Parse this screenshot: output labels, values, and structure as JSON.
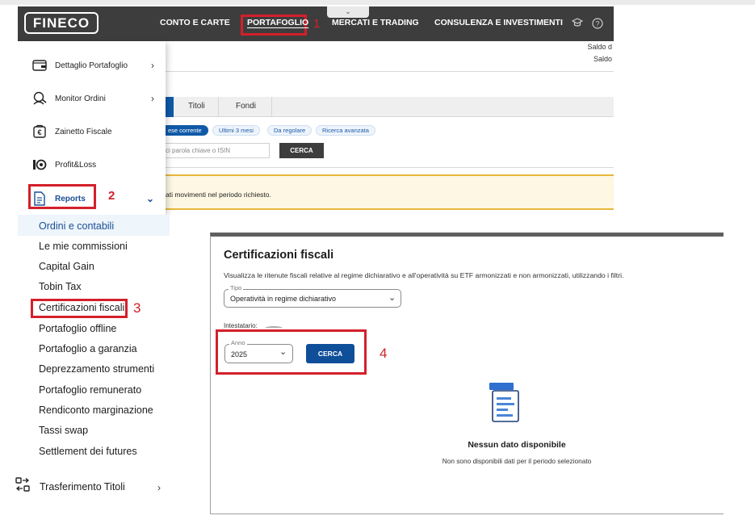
{
  "top_screenshot": {
    "logo": "FINECO",
    "nav": [
      "CONTO E CARTE",
      "PORTAFOGLIO",
      "MERCATI E TRADING",
      "CONSULENZA E INVESTIMENTI"
    ],
    "step1": "1",
    "saldo_lines": [
      "Saldo d",
      "Saldo"
    ],
    "dropdown": {
      "items": [
        {
          "label": "Dettaglio Portafoglio",
          "icon": "wallet-icon"
        },
        {
          "label": "Monitor Ordini",
          "icon": "order-monitor-icon"
        },
        {
          "label": "Zainetto Fiscale",
          "icon": "tax-backpack-icon"
        },
        {
          "label": "Profit&Loss",
          "icon": "profit-loss-icon"
        },
        {
          "label": "Reports",
          "icon": "document-icon"
        }
      ],
      "step2": "2"
    },
    "subtabs": [
      "Titoli",
      "Fondi"
    ],
    "filters": [
      "ese corrente",
      "Ultimi 3 mesi",
      "Da regolare",
      "Ricerca avanzata"
    ],
    "search_placeholder": "sci parola chiave o ISIN",
    "search_button": "CERCA",
    "banner_text": "ati movimenti nel periodo richiesto."
  },
  "reports_submenu": {
    "items": [
      "Ordini e contabili",
      "Le mie commissioni",
      "Capital Gain",
      "Tobin Tax",
      "Certificazioni fiscali",
      "Portafoglio offline",
      "Portafoglio a garanzia",
      "Deprezzamento strumenti",
      "Portafoglio remunerato",
      "Rendiconto marginazione",
      "Tassi swap",
      "Settlement dei futures"
    ],
    "step3": "3",
    "transfer_label": "Trasferimento Titoli"
  },
  "certificazioni": {
    "title": "Certificazioni fiscali",
    "description": "Visualizza le ritenute fiscali relative al regime dichiarativo e all'operatività su ETF armonizzati e non armonizzati, utilizzando i filtri.",
    "tipo_label": "Tipo",
    "tipo_value": "Operatività in regime dichiarativo",
    "intestatario_label": "Intestatario:",
    "anno_label": "Anno",
    "anno_value": "2025",
    "button": "CERCA",
    "step4": "4",
    "empty_title": "Nessun dato disponibile",
    "empty_desc": "Non sono disponibili dati per il periodo selezionato"
  },
  "colors": {
    "annotation_red": "#d3202a",
    "brand_blue": "#0f4f9a",
    "navbar": "#3d3d3d"
  }
}
